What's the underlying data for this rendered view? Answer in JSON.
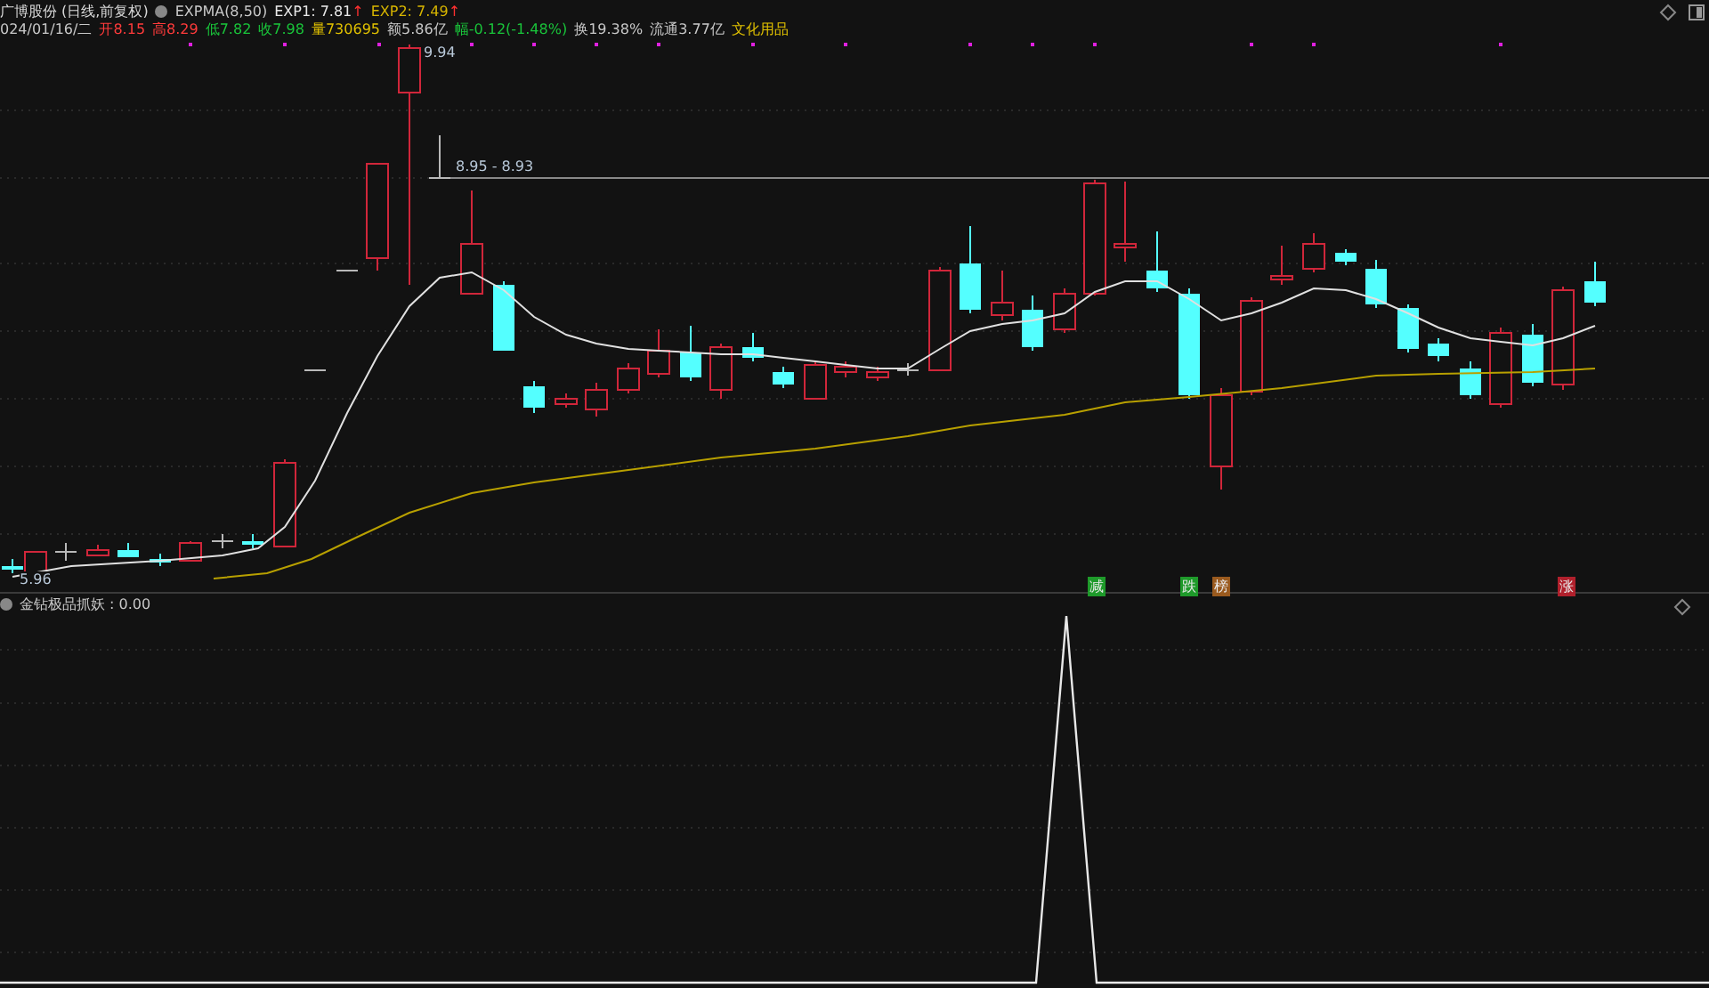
{
  "header": {
    "stock_title": "广博股份 (日线,前复权)",
    "indicator": "EXPMA(8,50)",
    "exp_values": [
      {
        "label": "EXP1: 7.81",
        "arrow": "↑",
        "color": "#e8e8e8"
      },
      {
        "label": "EXP2: 7.49",
        "arrow": "↑",
        "color": "#d6b400"
      }
    ]
  },
  "quote": {
    "date": "024/01/16/二",
    "fields": [
      {
        "text": "开8.15",
        "color": "#ff3b3b"
      },
      {
        "text": "高8.29",
        "color": "#ff3b3b"
      },
      {
        "text": "低7.82",
        "color": "#19c43a"
      },
      {
        "text": "收7.98",
        "color": "#19c43a"
      },
      {
        "text": "量730695",
        "color": "#e0c000"
      },
      {
        "text": "额5.86亿",
        "color": "#c8c8c8"
      },
      {
        "text": "幅-0.12(-1.48%)",
        "color": "#19c43a"
      },
      {
        "text": "换19.38%",
        "color": "#c8c8c8"
      },
      {
        "text": "流通3.77亿",
        "color": "#c8c8c8"
      },
      {
        "text": "文化用品",
        "color": "#e0c000"
      }
    ]
  },
  "price_labels": {
    "high": "9.94",
    "low": "5.96",
    "range": "8.95 - 8.93"
  },
  "signals": [
    {
      "text": "减",
      "color": "#1e9a2a"
    },
    {
      "text": "跌",
      "color": "#1e9a2a"
    },
    {
      "text": "榜",
      "color": "#9a5a1e"
    },
    {
      "text": "涨",
      "color": "#b0202c"
    }
  ],
  "lower_panel": {
    "label": "金钻极品抓妖 : 0.00"
  }
}
